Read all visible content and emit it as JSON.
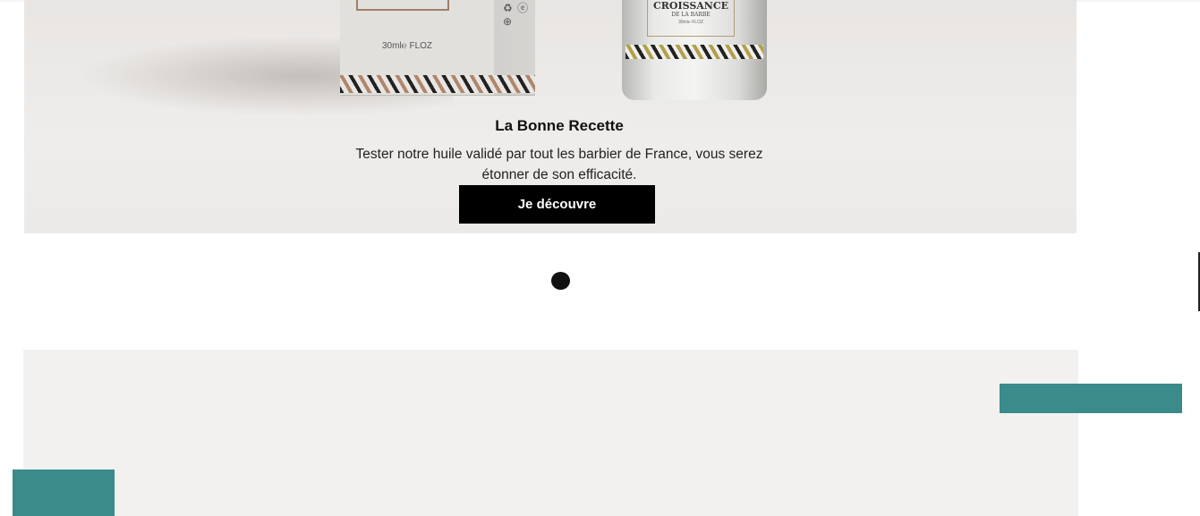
{
  "hero": {
    "title": "La Bonne Recette",
    "description": "Tester notre huile validé par tout les barbier de France, vous serez étonner de son efficacité.",
    "cta_label": "Je découvre",
    "product_box": {
      "volume": "30ml℮ FLOZ",
      "side_icons": "♻ ⓔ ⊕"
    },
    "product_bottle": {
      "brand": "CROISSANCE",
      "subtitle": "DE LA BARBE",
      "volume": "30ml℮ FLOZ"
    }
  },
  "carousel": {
    "slide_count": 1,
    "active_index": 0
  },
  "colors": {
    "accent_teal": "#3a8b8a",
    "cta_background": "#000000",
    "panel_background": "#f2f1ef"
  }
}
